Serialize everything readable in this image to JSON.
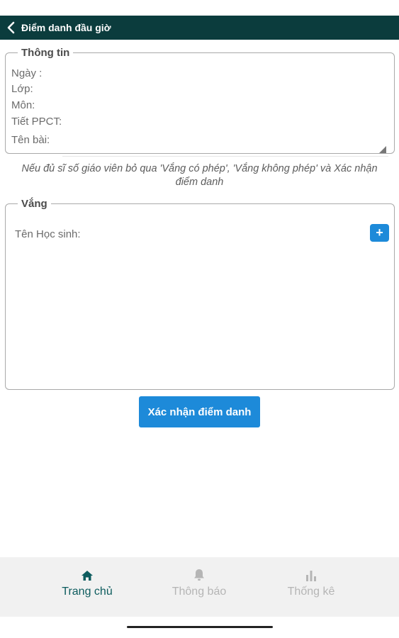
{
  "header": {
    "title": "Điểm danh đầu giờ"
  },
  "info": {
    "legend": "Thông tin",
    "date_label": "Ngày :",
    "class_label": "Lớp:",
    "subject_label": "Môn:",
    "period_label": "Tiết PPCT:",
    "lesson_label": "Tên bài:",
    "lesson_value": ""
  },
  "note": "Nếu đủ sĩ số giáo viên bỏ qua 'Vắng có phép', 'Vắng không phép' và Xác nhận điểm danh",
  "absent": {
    "legend": "Vắng",
    "student_label": "Tên Học sinh:",
    "add_label": "+"
  },
  "confirm_button": "Xác nhận điểm danh",
  "nav": {
    "items": [
      {
        "label": "Trang chủ",
        "icon": "home-icon",
        "active": true
      },
      {
        "label": "Thông báo",
        "icon": "bell-icon",
        "active": false
      },
      {
        "label": "Thống kê",
        "icon": "bar-chart-icon",
        "active": false
      }
    ]
  },
  "colors": {
    "header_bg": "#0b3c3d",
    "accent": "#1d8ad9",
    "nav_active": "#0d5c5e",
    "nav_inactive": "#b5b5b5"
  }
}
